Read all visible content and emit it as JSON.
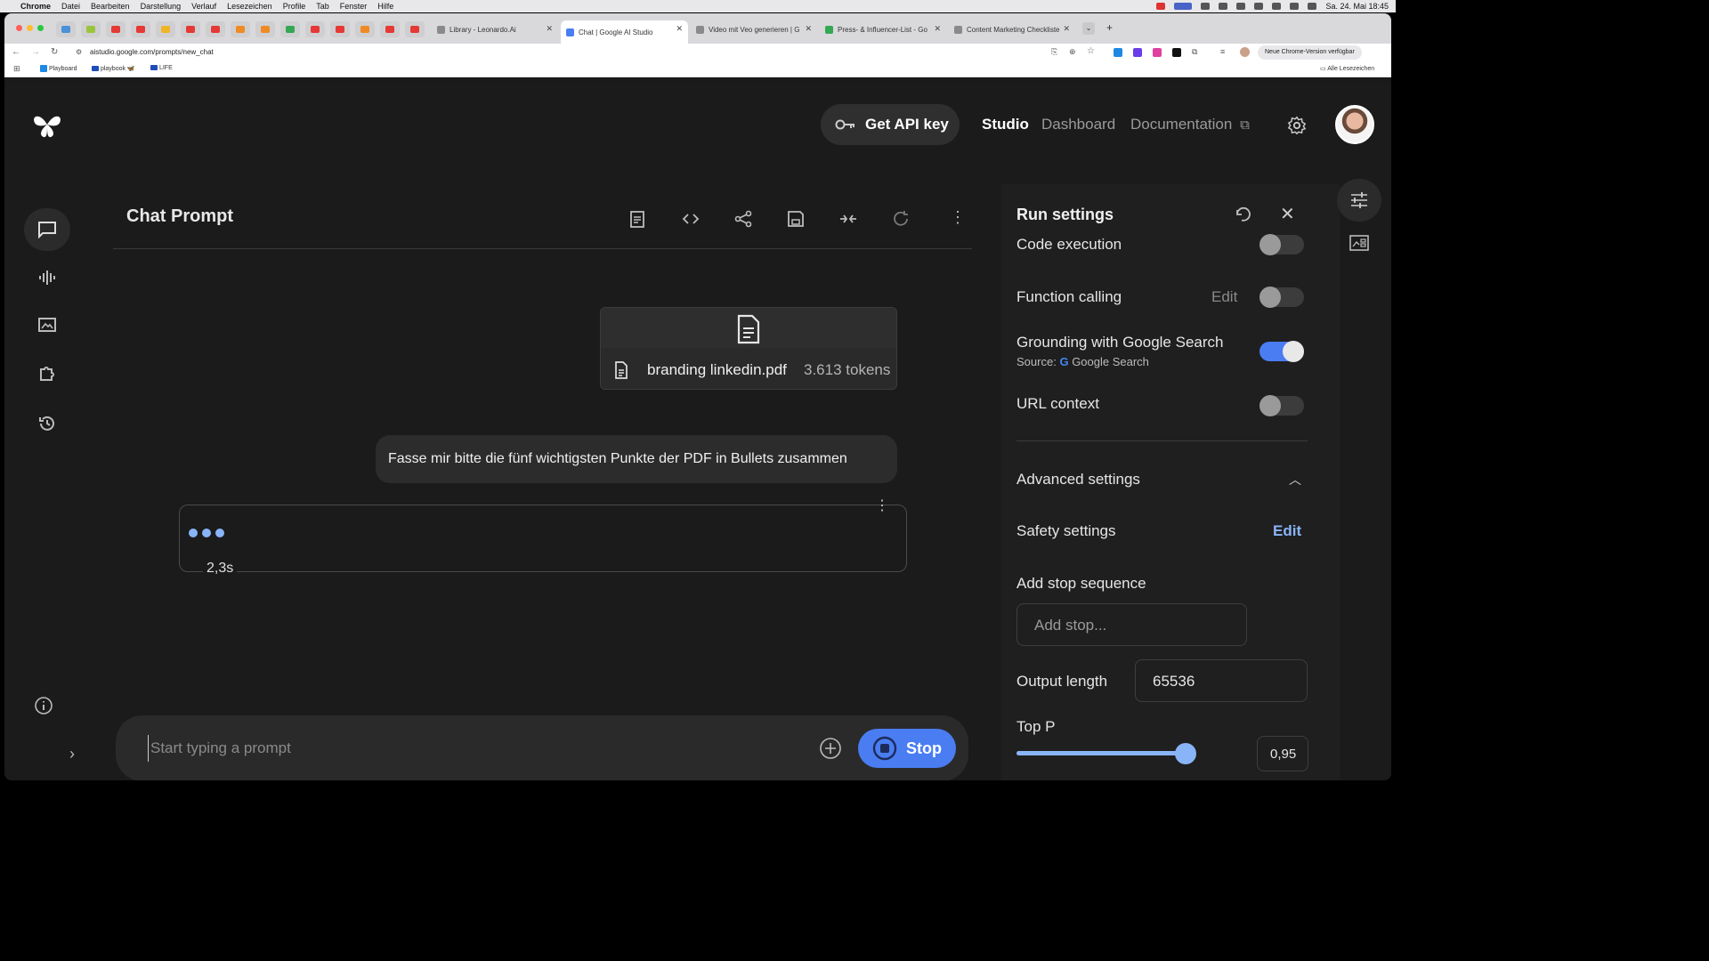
{
  "menubar": {
    "app": "Chrome",
    "items": [
      "Datei",
      "Bearbeiten",
      "Darstellung",
      "Verlauf",
      "Lesezeichen",
      "Profile",
      "Tab",
      "Fenster",
      "Hilfe"
    ],
    "datetime": "Sa. 24. Mai 18:45"
  },
  "tabs": [
    {
      "label": "Library - Leonardo.Ai"
    },
    {
      "label": "Chat | Google AI Studio"
    },
    {
      "label": "Video mit Veo generieren | G"
    },
    {
      "label": "Press- & Influencer-List - Go"
    },
    {
      "label": "Content Marketing Checkliste"
    }
  ],
  "address": {
    "url": "aistudio.google.com/prompts/new_chat",
    "update_label": "Neue Chrome-Version verfügbar"
  },
  "bookmarks": {
    "items": [
      "Playboard",
      "playbook 🦋",
      "LIFE"
    ],
    "all_label": "Alle Lesezeichen"
  },
  "header": {
    "get_api_key": "Get API key",
    "nav": {
      "studio": "Studio",
      "dashboard": "Dashboard",
      "documentation": "Documentation"
    }
  },
  "chat": {
    "title": "Chat Prompt",
    "file": {
      "name": "branding linkedin.pdf",
      "tokens": "3.613 tokens"
    },
    "user_message": "Fasse mir bitte die fünf wichtigsten Punkte der PDF in Bullets zusammen",
    "response_time": "2,3s",
    "prompt_placeholder": "Start typing a prompt",
    "stop_label": "Stop"
  },
  "settings": {
    "title": "Run settings",
    "code_execution": "Code execution",
    "function_calling": "Function calling",
    "function_edit": "Edit",
    "grounding": "Grounding with Google Search",
    "grounding_source_prefix": "Source:",
    "grounding_source": "Google Search",
    "url_context": "URL context",
    "advanced": "Advanced settings",
    "safety": "Safety settings",
    "safety_edit": "Edit",
    "stop_sequence": "Add stop sequence",
    "stop_placeholder": "Add stop...",
    "output_length_label": "Output length",
    "output_length_value": "65536",
    "top_p_label": "Top P",
    "top_p_value": "0,95",
    "top_p_fraction": 0.95,
    "toggles": {
      "code_execution": false,
      "function_calling": false,
      "grounding": true,
      "url_context": false
    }
  },
  "colors": {
    "accent": "#4a7df2",
    "dots": "#8ab4f8",
    "background": "#1b1b1b"
  }
}
